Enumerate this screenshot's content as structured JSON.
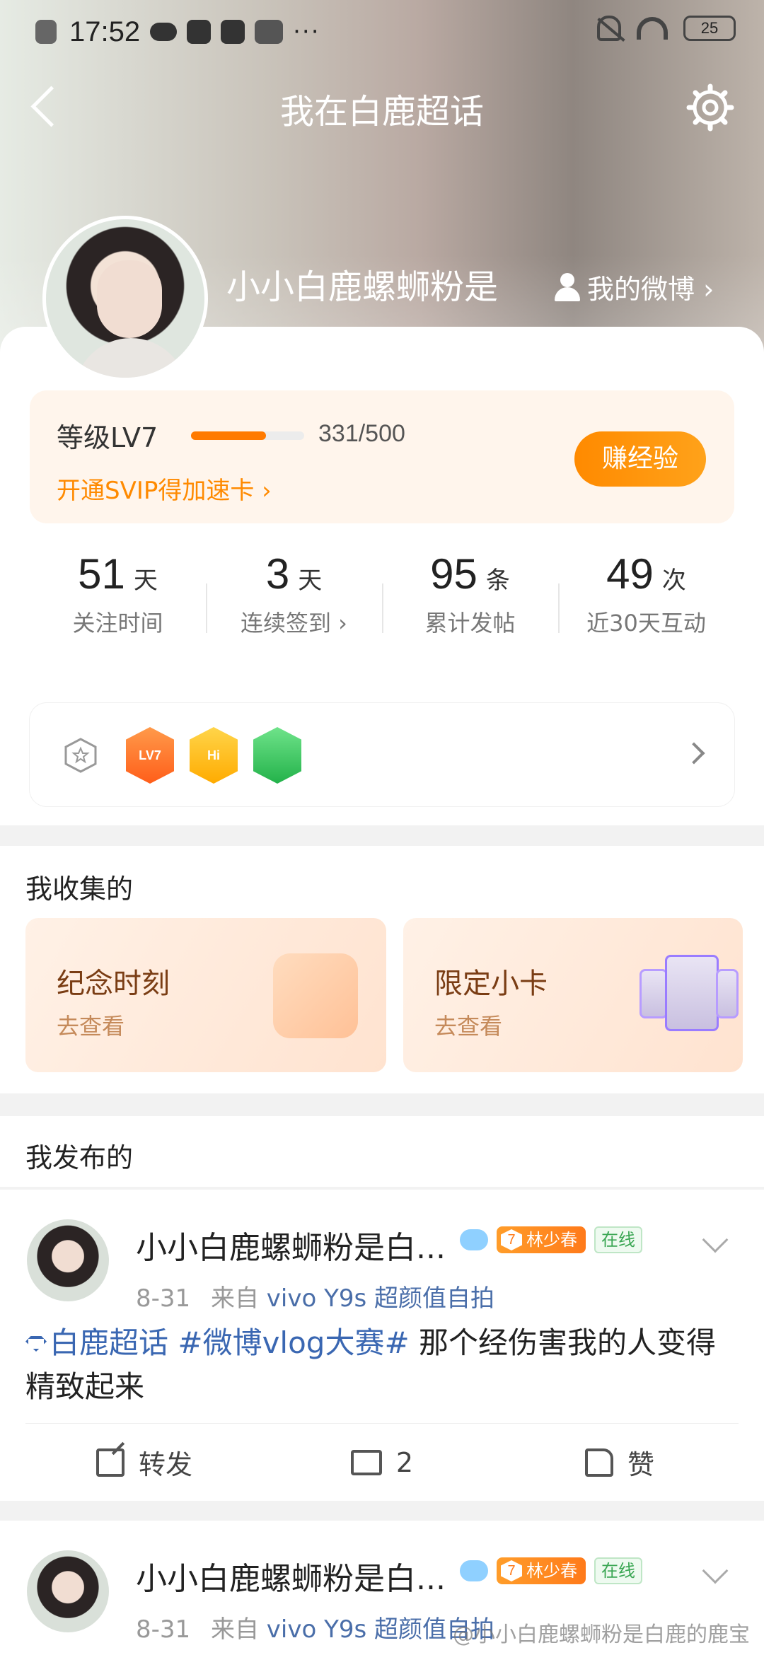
{
  "status_bar": {
    "time": "17:52",
    "battery": "25",
    "dots": "···"
  },
  "nav": {
    "title": "我在白鹿超话"
  },
  "profile": {
    "name": "小小白鹿螺蛳粉是",
    "my_weibo": "我的微博 ›"
  },
  "level": {
    "label": "等级LV7",
    "exp_text": "331/500",
    "progress_fraction": 0.662,
    "svip_link": "开通SVIP得加速卡 ›",
    "earn_button": "赚经验"
  },
  "stats": [
    {
      "num": "51",
      "unit": "天",
      "caption": "关注时间"
    },
    {
      "num": "3",
      "unit": "天",
      "caption": "连续签到 ›"
    },
    {
      "num": "95",
      "unit": "条",
      "caption": "累计发帖"
    },
    {
      "num": "49",
      "unit": "次",
      "caption": "近30天互动"
    }
  ],
  "badges": {
    "medal_1_text": "LV7",
    "medal_2_text": "Hi"
  },
  "collected": {
    "title": "我收集的",
    "cards": [
      {
        "title": "纪念时刻",
        "sub": "去查看"
      },
      {
        "title": "限定小卡",
        "sub": "去查看"
      }
    ]
  },
  "posted": {
    "title": "我发布的",
    "posts": [
      {
        "name": "小小白鹿螺蛳粉是白...",
        "fan_level": "7",
        "fan_tag": "林少春",
        "online": "在线",
        "date": "8-31",
        "source_prefix": "来自",
        "source": "vivo Y9s 超颜值自拍",
        "topic": "白鹿超话",
        "hashtag": "#微博vlog大赛#",
        "text": " 那个经伤害我的人变得精致起来",
        "actions": {
          "repost": "转发",
          "comment": "2",
          "like": "赞"
        }
      },
      {
        "name": "小小白鹿螺蛳粉是白...",
        "fan_level": "7",
        "fan_tag": "林少春",
        "online": "在线",
        "date": "8-31",
        "source_prefix": "来自",
        "source": "vivo Y9s 超颜值自拍"
      }
    ]
  },
  "watermark": "@小小白鹿螺蛳粉是白鹿的鹿宝",
  "colors": {
    "accent_orange": "#ff8a00",
    "link_blue": "#3a67b2",
    "online_green": "#3aa653"
  }
}
